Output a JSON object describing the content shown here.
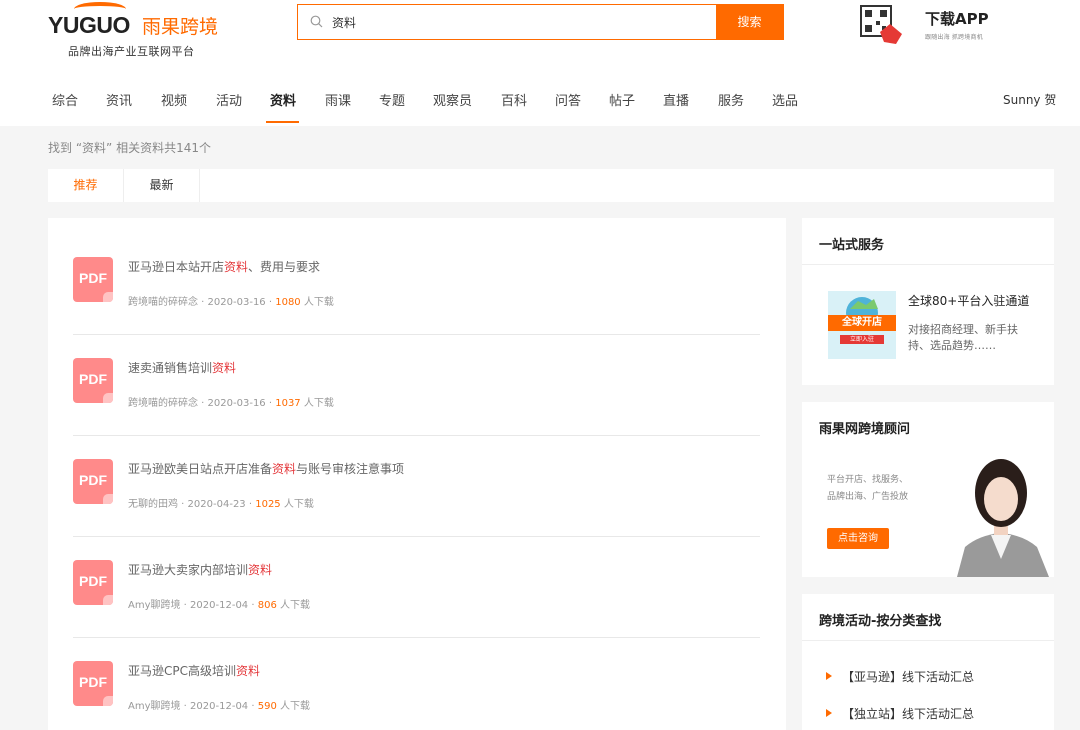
{
  "brand": {
    "name_en": "YUGUO",
    "name_cn": "雨果跨境",
    "slogan": "品牌出海产业互联网平台"
  },
  "search": {
    "value": "资料",
    "button": "搜索"
  },
  "app": {
    "title": "下载APP",
    "subtitle": "跟随出海 抓跨境商机"
  },
  "nav": {
    "items": [
      "综合",
      "资讯",
      "视频",
      "活动",
      "资料",
      "雨课",
      "专题",
      "观察员",
      "百科",
      "问答",
      "帖子",
      "直播",
      "服务",
      "选品"
    ],
    "active": "资料",
    "user": "Sunny 贺"
  },
  "results": {
    "found_text": "找到 “资料” 相关资料共141个"
  },
  "tabs": [
    "推荐",
    "最新"
  ],
  "docs": [
    {
      "icon": "PDF",
      "pre": "亚马逊日本站开店",
      "hl": "资料",
      "post": "、费用与要求",
      "author": "跨境喵的碎碎念",
      "date": "2020-03-16",
      "count": "1080",
      "suffix": "人下载"
    },
    {
      "icon": "PDF",
      "pre": "速卖通销售培训",
      "hl": "资料",
      "post": "",
      "author": "跨境喵的碎碎念",
      "date": "2020-03-16",
      "count": "1037",
      "suffix": "人下载"
    },
    {
      "icon": "PDF",
      "pre": "亚马逊欧美日站点开店准备",
      "hl": "资料",
      "post": "与账号审核注意事项",
      "author": "无聊的田鸡",
      "date": "2020-04-23",
      "count": "1025",
      "suffix": "人下载"
    },
    {
      "icon": "PDF",
      "pre": "亚马逊大卖家内部培训",
      "hl": "资料",
      "post": "",
      "author": "Amy聊跨境",
      "date": "2020-12-04",
      "count": "806",
      "suffix": "人下载"
    },
    {
      "icon": "PDF",
      "pre": "亚马逊CPC高级培训",
      "hl": "资料",
      "post": "",
      "author": "Amy聊跨境",
      "date": "2020-12-04",
      "count": "590",
      "suffix": "人下载"
    }
  ],
  "side": {
    "service": {
      "title": "一站式服务",
      "img_text": "全球开店",
      "img_sub": "立即入驻",
      "item_title": "全球80+平台入驻通道",
      "item_desc": "对接招商经理、新手扶持、选品趋势……"
    },
    "advisor": {
      "title": "雨果网跨境顾问",
      "line1": "平台开店、找服务、",
      "line2": "品牌出海、广告投放",
      "button": "点击咨询"
    },
    "events": {
      "title": "跨境活动-按分类查找",
      "items": [
        "【亚马逊】线下活动汇总",
        "【独立站】线下活动汇总"
      ]
    }
  },
  "colors": {
    "accent": "#ff6a00",
    "highlight": "#e4393c",
    "pdf": "#ff8a8a"
  }
}
